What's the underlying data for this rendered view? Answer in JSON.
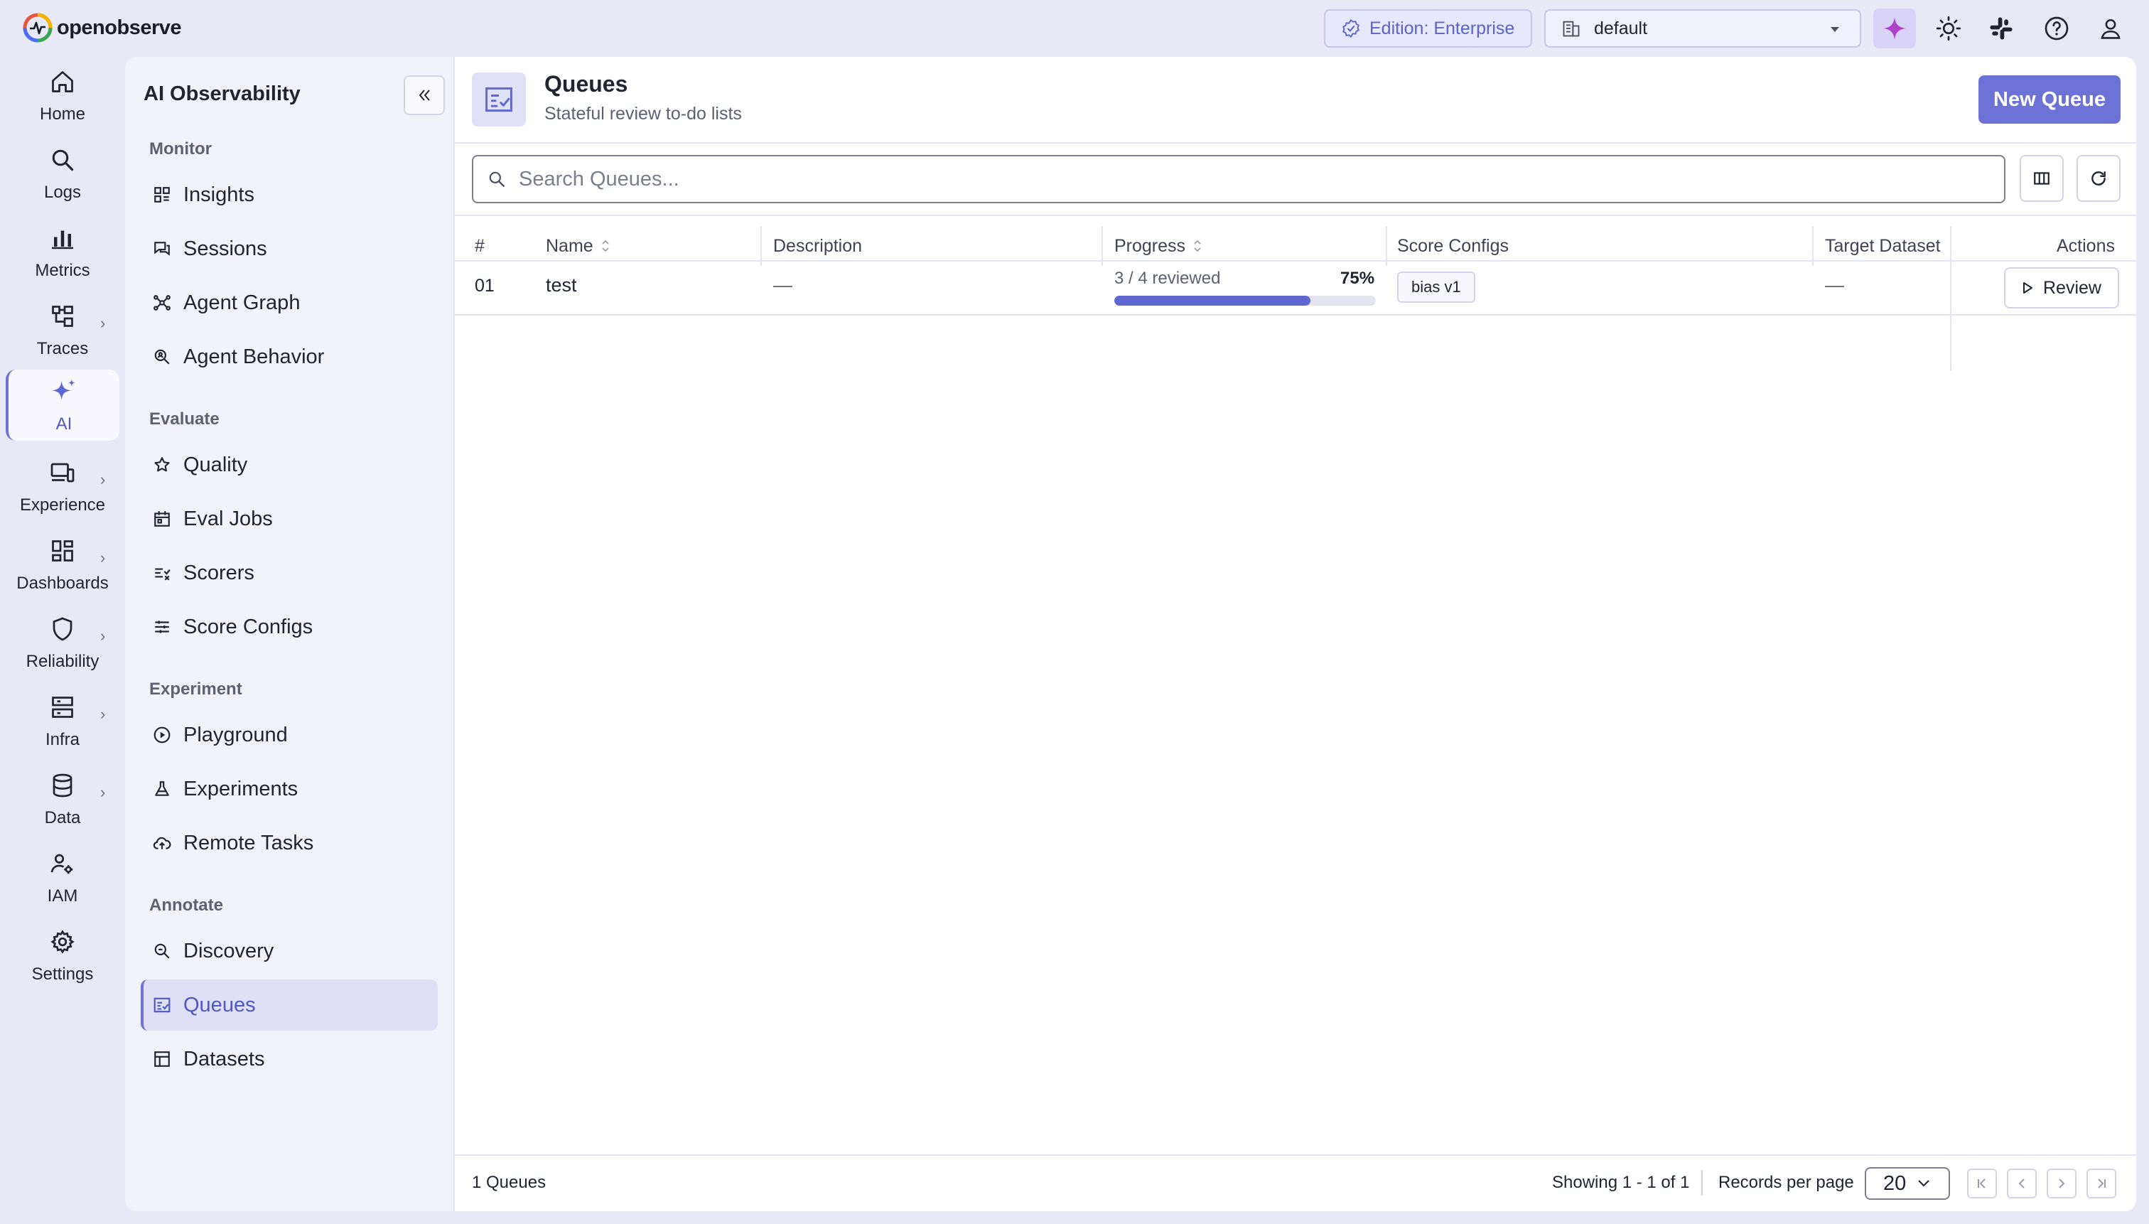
{
  "app": {
    "logo_text": "openobserve"
  },
  "header": {
    "edition_label": "Edition: Enterprise",
    "org_value": "default",
    "accent": "#6d73d6",
    "icons": [
      "ai-sparkle-icon",
      "sun-icon",
      "slack-icon",
      "help-icon",
      "user-icon"
    ]
  },
  "nav": {
    "items": [
      {
        "label": "Home",
        "icon": "home-icon",
        "has_submenu": false
      },
      {
        "label": "Logs",
        "icon": "search-icon",
        "has_submenu": false
      },
      {
        "label": "Metrics",
        "icon": "bar-chart-icon",
        "has_submenu": false
      },
      {
        "label": "Traces",
        "icon": "traces-icon",
        "has_submenu": true
      },
      {
        "label": "AI",
        "icon": "sparkle-icon",
        "has_submenu": false,
        "active": true
      },
      {
        "label": "Experience",
        "icon": "devices-icon",
        "has_submenu": true
      },
      {
        "label": "Dashboards",
        "icon": "dashboard-icon",
        "has_submenu": true
      },
      {
        "label": "Reliability",
        "icon": "shield-icon",
        "has_submenu": true
      },
      {
        "label": "Infra",
        "icon": "server-icon",
        "has_submenu": true
      },
      {
        "label": "Data",
        "icon": "database-icon",
        "has_submenu": true
      },
      {
        "label": "IAM",
        "icon": "users-icon",
        "has_submenu": false
      },
      {
        "label": "Settings",
        "icon": "gear-icon",
        "has_submenu": false
      }
    ]
  },
  "subnav": {
    "title": "AI Observability",
    "sections": [
      {
        "heading": "Monitor",
        "items": [
          "Insights",
          "Sessions",
          "Agent Graph",
          "Agent Behavior"
        ]
      },
      {
        "heading": "Evaluate",
        "items": [
          "Quality",
          "Eval Jobs",
          "Scorers",
          "Score Configs"
        ]
      },
      {
        "heading": "Experiment",
        "items": [
          "Playground",
          "Experiments",
          "Remote Tasks"
        ]
      },
      {
        "heading": "Annotate",
        "items": [
          "Discovery",
          "Queues",
          "Datasets"
        ]
      }
    ],
    "active_item": "Queues"
  },
  "page": {
    "title": "Queues",
    "subtitle": "Stateful review to-do lists",
    "new_button": "New Queue",
    "search_placeholder": "Search Queues..."
  },
  "table": {
    "columns": [
      "#",
      "Name",
      "Description",
      "Progress",
      "Score Configs",
      "Target Dataset",
      "Actions"
    ],
    "rows": [
      {
        "index": "01",
        "name": "test",
        "description": "—",
        "progress_text": "3 / 4 reviewed",
        "progress_pct_label": "75%",
        "progress_fraction": 0.75,
        "score_config": "bias v1",
        "target_dataset": "—",
        "action": "Review"
      }
    ]
  },
  "footer": {
    "count": "1 Queues",
    "showing": "Showing 1 - 1 of 1",
    "rpp_label": "Records per page",
    "rpp_value": "20"
  }
}
